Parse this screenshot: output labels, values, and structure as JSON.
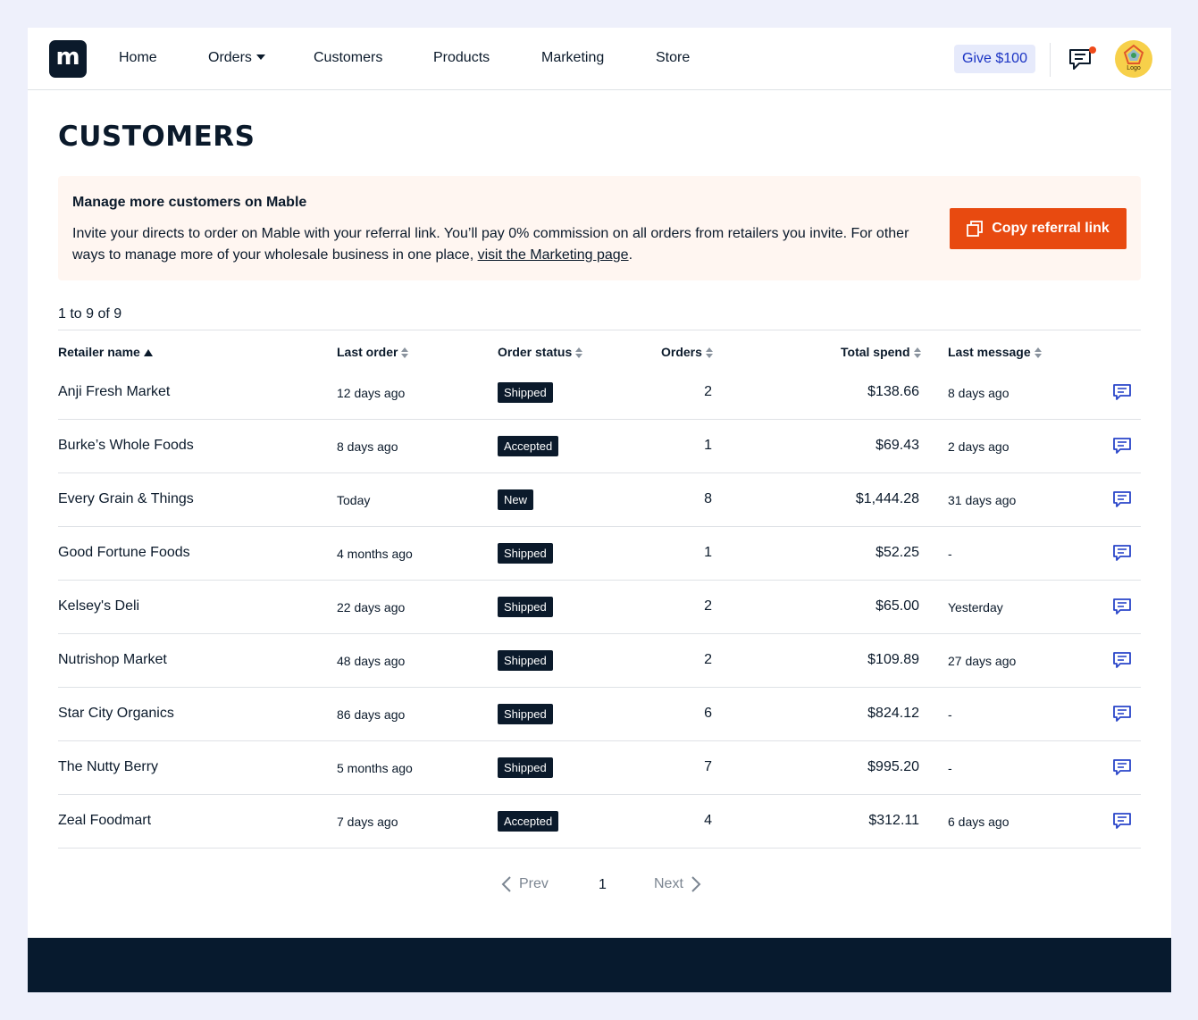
{
  "nav": {
    "logo": "m",
    "items": [
      "Home",
      "Orders",
      "Customers",
      "Products",
      "Marketing",
      "Store"
    ],
    "give_label": "Give $100",
    "avatar_text": "Logo"
  },
  "page": {
    "title": "CUSTOMERS"
  },
  "banner": {
    "title": "Manage more customers on Mable",
    "body": "Invite your directs to order on Mable with your referral link. You’ll pay 0% commission on all orders from retailers you invite. For other ways to manage more of your wholesale business in one place, ",
    "link": "visit the Marketing page",
    "end": ".",
    "button": "Copy referral link"
  },
  "table": {
    "count_text": "1 to 9 of 9",
    "headers": [
      "Retailer name",
      "Last order",
      "Order status",
      "Orders",
      "Total spend",
      "Last message"
    ],
    "rows": [
      {
        "name": "Anji Fresh Market",
        "last": "12 days ago",
        "status": "Shipped",
        "orders": "2",
        "spend": "$138.66",
        "msg": "8 days ago"
      },
      {
        "name": "Burke’s Whole Foods",
        "last": "8 days ago",
        "status": "Accepted",
        "orders": "1",
        "spend": "$69.43",
        "msg": "2 days ago"
      },
      {
        "name": "Every Grain & Things",
        "last": "Today",
        "status": "New",
        "orders": "8",
        "spend": "$1,444.28",
        "msg": "31 days ago"
      },
      {
        "name": "Good Fortune Foods",
        "last": "4 months ago",
        "status": "Shipped",
        "orders": "1",
        "spend": "$52.25",
        "msg": "-"
      },
      {
        "name": "Kelsey's Deli",
        "last": "22 days ago",
        "status": "Shipped",
        "orders": "2",
        "spend": "$65.00",
        "msg": "Yesterday"
      },
      {
        "name": "Nutrishop Market",
        "last": "48 days ago",
        "status": "Shipped",
        "orders": "2",
        "spend": "$109.89",
        "msg": "27 days ago"
      },
      {
        "name": "Star City Organics",
        "last": "86 days ago",
        "status": "Shipped",
        "orders": "6",
        "spend": "$824.12",
        "msg": "-"
      },
      {
        "name": "The Nutty Berry",
        "last": "5 months ago",
        "status": "Shipped",
        "orders": "7",
        "spend": "$995.20",
        "msg": "-"
      },
      {
        "name": "Zeal Foodmart",
        "last": "7 days ago",
        "status": "Accepted",
        "orders": "4",
        "spend": "$312.11",
        "msg": "6 days ago"
      }
    ]
  },
  "pagination": {
    "prev": "Prev",
    "page": "1",
    "next": "Next"
  },
  "colors": {
    "brand_dark": "#0b1a2b",
    "accent_orange": "#e84a10",
    "link_blue": "#1b34c4",
    "notification": "#ef4a1a"
  }
}
